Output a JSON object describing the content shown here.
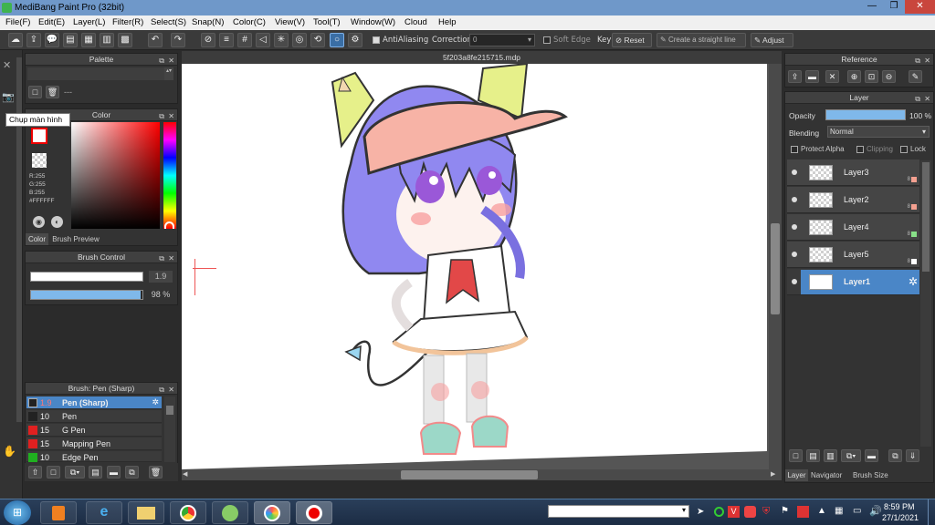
{
  "window": {
    "title": "MediBang Paint Pro (32bit)",
    "min": "—",
    "max": "❐",
    "close": "✕"
  },
  "menu": [
    "File(F)",
    "Edit(E)",
    "Layer(L)",
    "Filter(R)",
    "Select(S)",
    "Snap(N)",
    "Color(C)",
    "View(V)",
    "Tool(T)",
    "Window(W)",
    "Cloud",
    "Help"
  ],
  "toolbar": {
    "antialiasing": "AntiAliasing",
    "correction_label": "Correction",
    "correction_value": "0",
    "soft_edge": "Soft Edge",
    "key": "Key",
    "reset": "Reset",
    "straight_line": "Create a straight line",
    "adjust": "Adjust"
  },
  "tooltip": "Chụp màn hình",
  "palette": {
    "title": "Palette",
    "dash": "---"
  },
  "color": {
    "title": "Color",
    "r": "R:255",
    "g": "G:255",
    "b": "B:255",
    "hex": "#FFFFFF",
    "tab1": "Color",
    "tab2": "Brush Preview",
    "accent": "#ff0000"
  },
  "brush_control": {
    "title": "Brush Control",
    "size": "1.9",
    "opacity": "98 %",
    "opacity_fraction": 0.98
  },
  "brush_list": {
    "title": "Brush: Pen (Sharp)",
    "items": [
      {
        "size": "1.9",
        "name": "Pen (Sharp)",
        "color": "#222222"
      },
      {
        "size": "10",
        "name": "Pen",
        "color": "#222222"
      },
      {
        "size": "15",
        "name": "G Pen",
        "color": "#e02020"
      },
      {
        "size": "15",
        "name": "Mapping Pen",
        "color": "#e02020"
      },
      {
        "size": "10",
        "name": "Edge Pen",
        "color": "#20b020"
      }
    ]
  },
  "canvas": {
    "filename": "5f203a8fe215715.mdp"
  },
  "reference": {
    "title": "Reference"
  },
  "layer_panel": {
    "title": "Layer",
    "opacity_label": "Opacity",
    "opacity_value": "100 %",
    "blending_label": "Blending",
    "blending_value": "Normal",
    "protect_alpha": "Protect Alpha",
    "clipping": "Clipping",
    "lock": "Lock",
    "layers": [
      {
        "name": "Layer3",
        "bits": "8",
        "color": "#f4a090"
      },
      {
        "name": "Layer2",
        "bits": "8",
        "color": "#f4a090"
      },
      {
        "name": "Layer4",
        "bits": "8",
        "color": "#88e088"
      },
      {
        "name": "Layer5",
        "bits": "8",
        "color": "#ffffff"
      },
      {
        "name": "Layer1",
        "bits": "",
        "color": ""
      }
    ],
    "tabs": [
      "Layer",
      "Navigator",
      "Brush Size"
    ]
  },
  "taskbar": {
    "time": "8:59 PM",
    "date": "27/1/2021"
  }
}
